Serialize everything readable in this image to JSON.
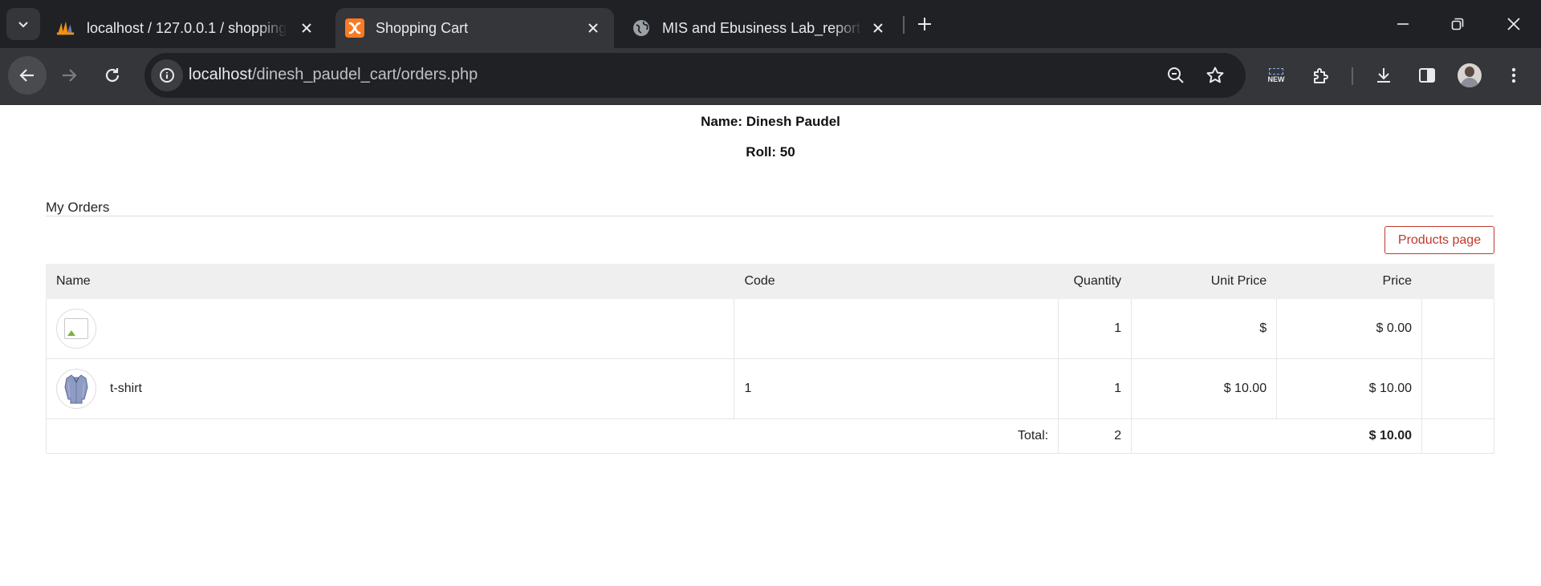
{
  "browser": {
    "tabs": [
      {
        "title": "localhost / 127.0.0.1 / shopping",
        "icon": "phpmyadmin-icon",
        "active": false
      },
      {
        "title": "Shopping Cart",
        "icon": "xampp-icon",
        "active": true
      },
      {
        "title": "MIS and Ebusiness Lab_report.p",
        "icon": "globe-icon",
        "active": false
      }
    ],
    "url_host": "localhost",
    "url_path": "/dinesh_paudel_cart/orders.php",
    "new_badge": "NEW",
    "accent_colors": {
      "tabbar": "#202124",
      "toolbar": "#35363a",
      "products_button": "#c0392b"
    }
  },
  "page": {
    "student_name": "Name: Dinesh Paudel",
    "student_roll": "Roll: 50",
    "section_title": "My Orders",
    "products_button": "Products page",
    "table": {
      "columns": {
        "name": "Name",
        "code": "Code",
        "quantity": "Quantity",
        "unit_price": "Unit Price",
        "price": "Price"
      },
      "rows": [
        {
          "image": "broken-image",
          "name": "",
          "code": "",
          "quantity": "1",
          "unit_price": "$",
          "price": "$ 0.00"
        },
        {
          "image": "tshirt-thumbnail",
          "name": "t-shirt",
          "code": "1",
          "quantity": "1",
          "unit_price": "$ 10.00",
          "price": "$ 10.00"
        }
      ],
      "footer": {
        "label": "Total:",
        "quantity": "2",
        "price": "$ 10.00"
      }
    }
  }
}
